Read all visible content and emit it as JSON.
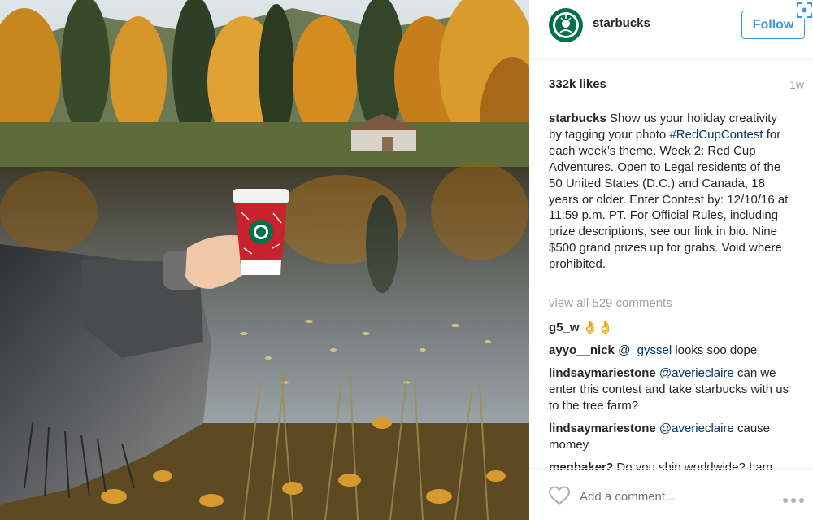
{
  "post": {
    "username": "starbucks",
    "follow_label": "Follow",
    "likes": "332k likes",
    "time_ago": "1w",
    "caption": {
      "username": "starbucks",
      "text_before": "Show us your holiday creativity by tagging your photo",
      "hashtag": "#RedCupContest",
      "text_after": "for each week’s theme. Week 2: Red Cup Adventures. Open to Legal residents of the 50 United States (D.C.) and Canada, 18 years or older. Enter Contest by: 12/10/16 at 11:59 p.m. PT. For Official Rules, including prize descriptions, see our link in bio. Nine $500 grand prizes up for grabs. Void where prohibited."
    },
    "view_all_comments": "view all 529 comments",
    "comments": [
      {
        "user": "g5_w",
        "mention": "",
        "text": "",
        "emoji": "👌👌"
      },
      {
        "user": "ayyo__nick",
        "mention": "@_gyssel",
        "text": "looks soo dope",
        "emoji": ""
      },
      {
        "user": "lindsaymariestone",
        "mention": "@averieclaire",
        "text": "can we enter this contest and take starbucks with us to the tree farm?",
        "emoji": ""
      },
      {
        "user": "lindsaymariestone",
        "mention": "@averieclaire",
        "text": "cause momey",
        "emoji": ""
      },
      {
        "user": "megbaker2",
        "mention": "",
        "text": "Do you ship worldwide? I am",
        "emoji": ""
      }
    ],
    "add_comment_placeholder": "Add a comment...",
    "icons": {
      "avatar": "starbucks-logo-icon",
      "like": "heart-icon",
      "more": "more-options-icon",
      "scan": "scan-icon"
    }
  },
  "colors": {
    "link_blue": "#3897f0",
    "hashtag": "#003569",
    "muted": "#a0a0a0",
    "starbucks_green": "#00704a",
    "cup_red": "#c8232c"
  }
}
